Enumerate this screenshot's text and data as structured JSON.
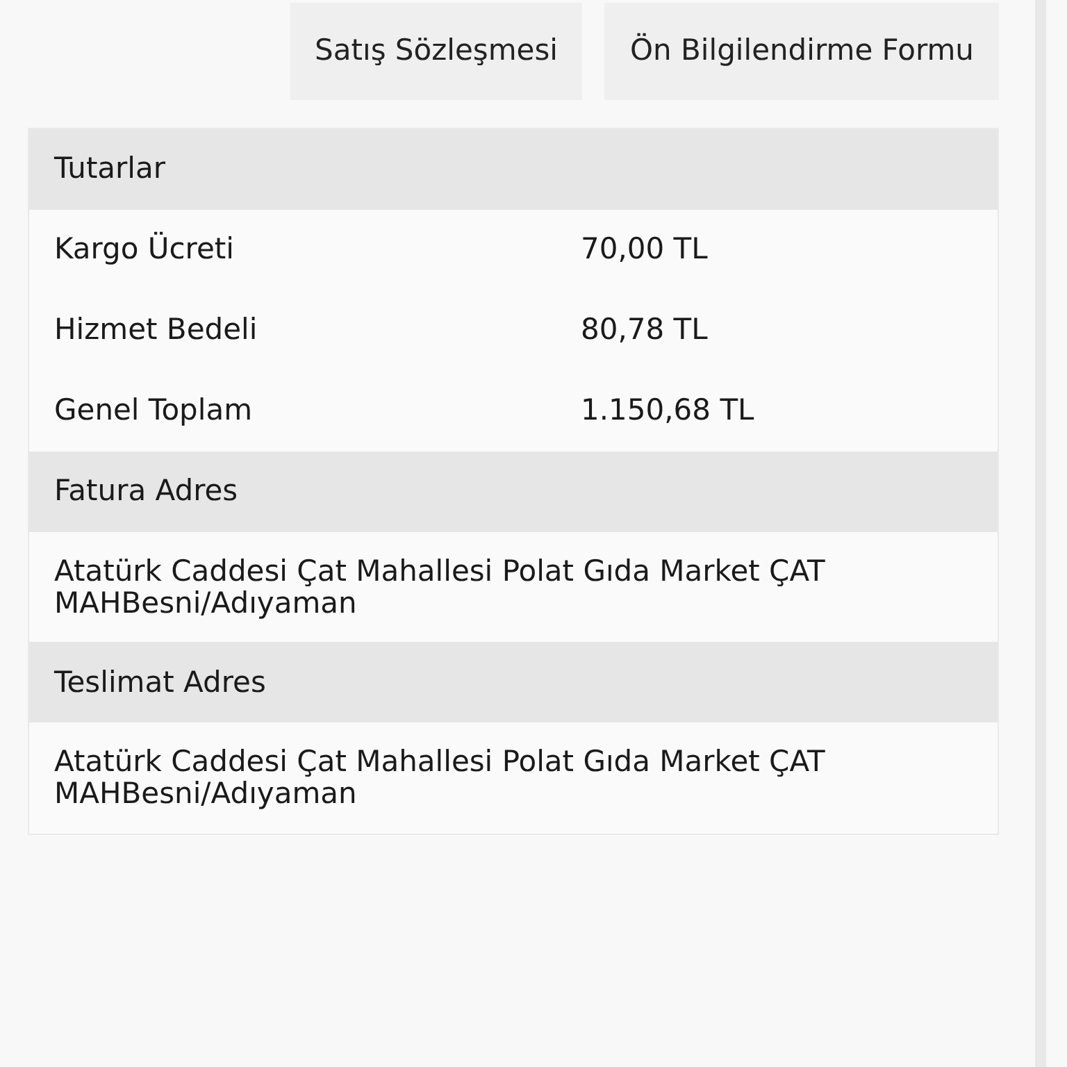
{
  "buttons": [
    "Satış Sözleşmesi",
    "Ön Bilgilendirme Formu"
  ],
  "sections": [
    {
      "title": "Tutarlar",
      "kind": "rows",
      "rows": [
        {
          "label": "Kargo Ücreti",
          "value": "70,00 TL"
        },
        {
          "label": "Hizmet Bedeli",
          "value": "80,78 TL"
        },
        {
          "label": "Genel Toplam",
          "value": "1.150,68 TL"
        }
      ]
    },
    {
      "title": "Fatura Adres",
      "kind": "text",
      "text": "Atatürk Caddesi Çat Mahallesi Polat Gıda Market ÇAT MAHBesni/Adıyaman"
    },
    {
      "title": "Teslimat Adres",
      "kind": "text",
      "text": "Atatürk Caddesi Çat Mahallesi Polat Gıda Market ÇAT MAHBesni/Adıyaman"
    }
  ]
}
